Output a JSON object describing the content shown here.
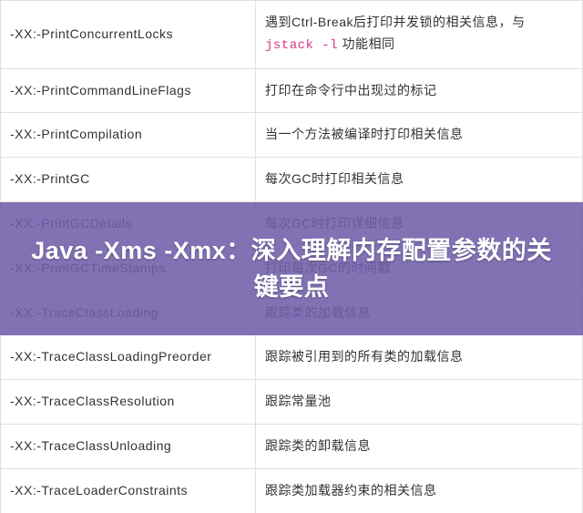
{
  "rows": [
    {
      "option": "-XX:-PrintConcurrentLocks",
      "desc_parts": [
        "遇到Ctrl-Break后打印并发锁的相关信息，与 ",
        "jstack -l",
        " 功能相同"
      ],
      "has_code": true
    },
    {
      "option": "-XX:-PrintCommandLineFlags",
      "desc": "打印在命令行中出现过的标记"
    },
    {
      "option": "-XX:-PrintCompilation",
      "desc": "当一个方法被编译时打印相关信息"
    },
    {
      "option": "-XX:-PrintGC",
      "desc": "每次GC时打印相关信息"
    },
    {
      "option": "-XX:-PrintGCDetails",
      "desc": "每次GC时打印详细信息"
    },
    {
      "option": "-XX:-PrintGCTimeStamps",
      "desc": "打印每次GC的时间戳"
    },
    {
      "option": "-XX:-TraceClassLoading",
      "desc": "跟踪类的加载信息"
    },
    {
      "option": "-XX:-TraceClassLoadingPreorder",
      "desc": "跟踪被引用到的所有类的加载信息"
    },
    {
      "option": "-XX:-TraceClassResolution",
      "desc": "跟踪常量池"
    },
    {
      "option": "-XX:-TraceClassUnloading",
      "desc": "跟踪类的卸载信息"
    },
    {
      "option": "-XX:-TraceLoaderConstraints",
      "desc": "跟踪类加载器约束的相关信息"
    }
  ],
  "overlay": {
    "title": "Java -Xms -Xmx：深入理解内存配置参数的关键要点"
  }
}
